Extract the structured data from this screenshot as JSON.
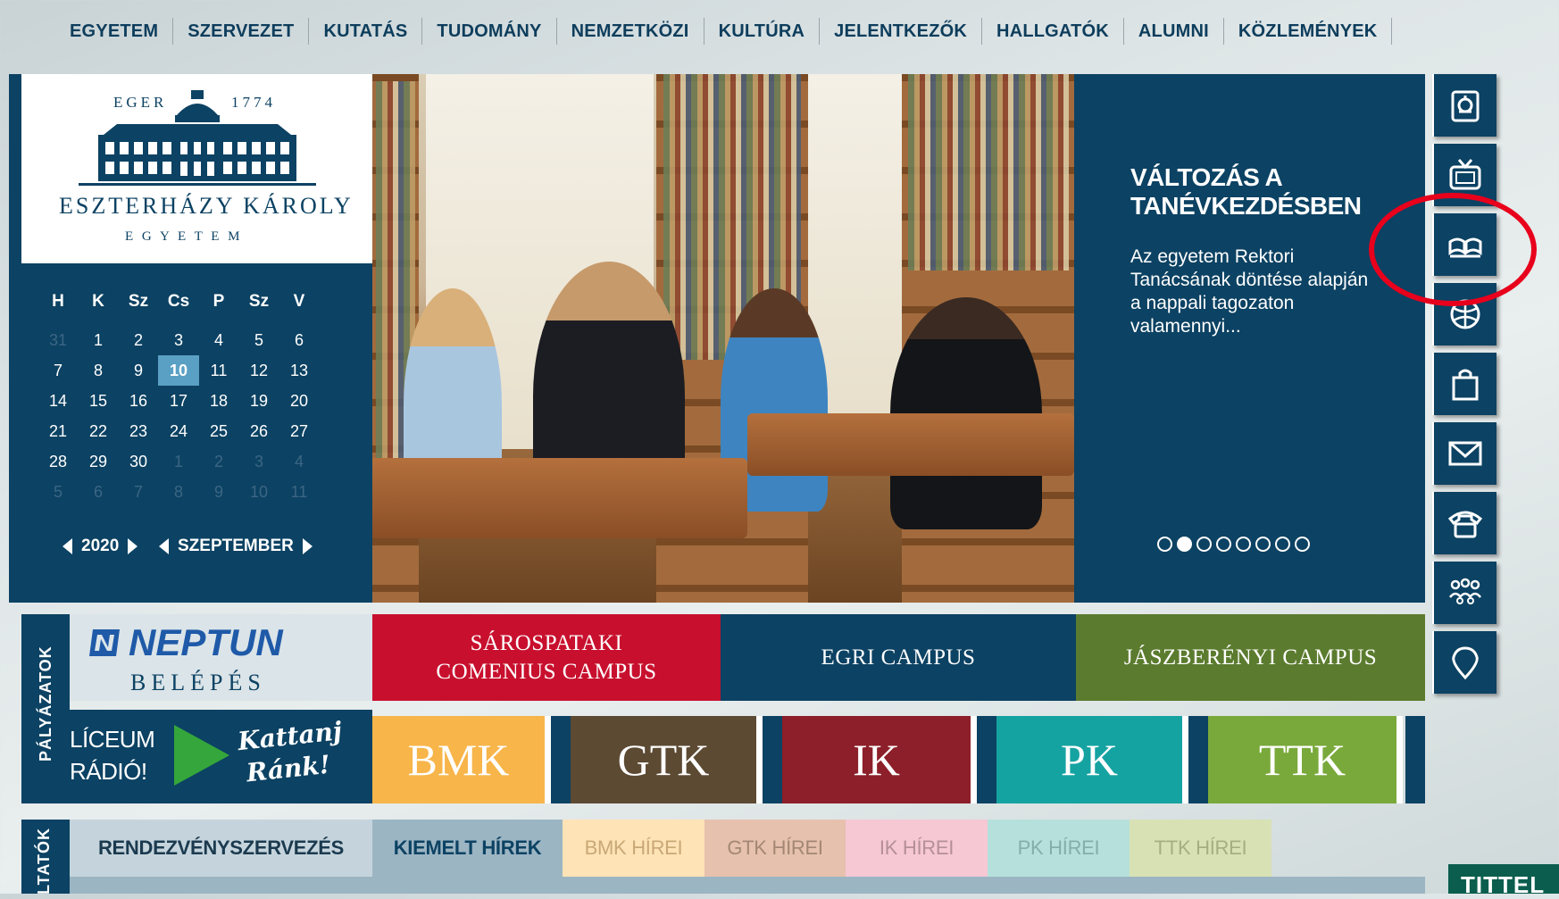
{
  "nav": {
    "items": [
      "EGYETEM",
      "SZERVEZET",
      "KUTATÁS",
      "TUDOMÁNY",
      "NEMZETKÖZI",
      "KULTÚRA",
      "JELENTKEZŐK",
      "HALLGATÓK",
      "ALUMNI",
      "KÖZLEMÉNYEK"
    ]
  },
  "logo": {
    "city": "EGER",
    "year": "1774",
    "name": "ESZTERHÁZY KÁROLY",
    "sub": "E G Y E T E M"
  },
  "calendar": {
    "day_names": [
      "H",
      "K",
      "Sz",
      "Cs",
      "P",
      "Sz",
      "V"
    ],
    "weeks": [
      [
        "31",
        "1",
        "2",
        "3",
        "4",
        "5",
        "6"
      ],
      [
        "7",
        "8",
        "9",
        "10",
        "11",
        "12",
        "13"
      ],
      [
        "14",
        "15",
        "16",
        "17",
        "18",
        "19",
        "20"
      ],
      [
        "21",
        "22",
        "23",
        "24",
        "25",
        "26",
        "27"
      ],
      [
        "28",
        "29",
        "30",
        "1",
        "2",
        "3",
        "4"
      ],
      [
        "5",
        "6",
        "7",
        "8",
        "9",
        "10",
        "11"
      ]
    ],
    "today": "10",
    "year": "2020",
    "month": "SZEPTEMBER"
  },
  "news": {
    "title": "VÁLTOZÁS A TANÉVKEZDÉSBEN",
    "text": "Az egyetem Rektori Tanácsának döntése alapján a nappali tagozaton valamennyi...",
    "slides": 8,
    "active_slide": 2
  },
  "right_icons": [
    "newspaper-icon",
    "tv-icon",
    "book-icon",
    "sports-ball-icon",
    "shopping-bag-icon",
    "mail-icon",
    "phone-icon",
    "people-icon",
    "location-pin-icon"
  ],
  "colors": {
    "navy": "#0c4263",
    "sarospatak": "#c8102e",
    "eger": "#0c4263",
    "jaszbereny": "#5b7b2e",
    "bmk": "#f7b54a",
    "gtk": "#5c4a33",
    "ik": "#8c1f29",
    "pk": "#15a3a2",
    "ttk": "#79a93a",
    "highlight": "#e8001c"
  },
  "side_labels": {
    "palyazatok": "PÁLYÁZATOK",
    "bottom": "LTATÓK"
  },
  "neptun": {
    "title": "NEPTUN",
    "sub": "BELÉPÉS"
  },
  "campuses": [
    {
      "label": "SÁROSPATAKI COMENIUS CAMPUS"
    },
    {
      "label": "EGRI CAMPUS"
    },
    {
      "label": "JÁSZBERÉNYI CAMPUS"
    }
  ],
  "radio": {
    "line1": "LÍCEUM",
    "line2": "RÁDIÓ!",
    "cta_line1": "Kattanj",
    "cta_line2": "Ránk!"
  },
  "faculties": [
    "BMK",
    "GTK",
    "IK",
    "PK",
    "TTK"
  ],
  "tabs": [
    "RENDEZVÉNYSZERVEZÉS",
    "KIEMELT HÍREK",
    "BMK HÍREI",
    "GTK HÍREI",
    "IK HÍREI",
    "PK HÍREI",
    "TTK HÍREI"
  ],
  "tittel": "TITTEL"
}
